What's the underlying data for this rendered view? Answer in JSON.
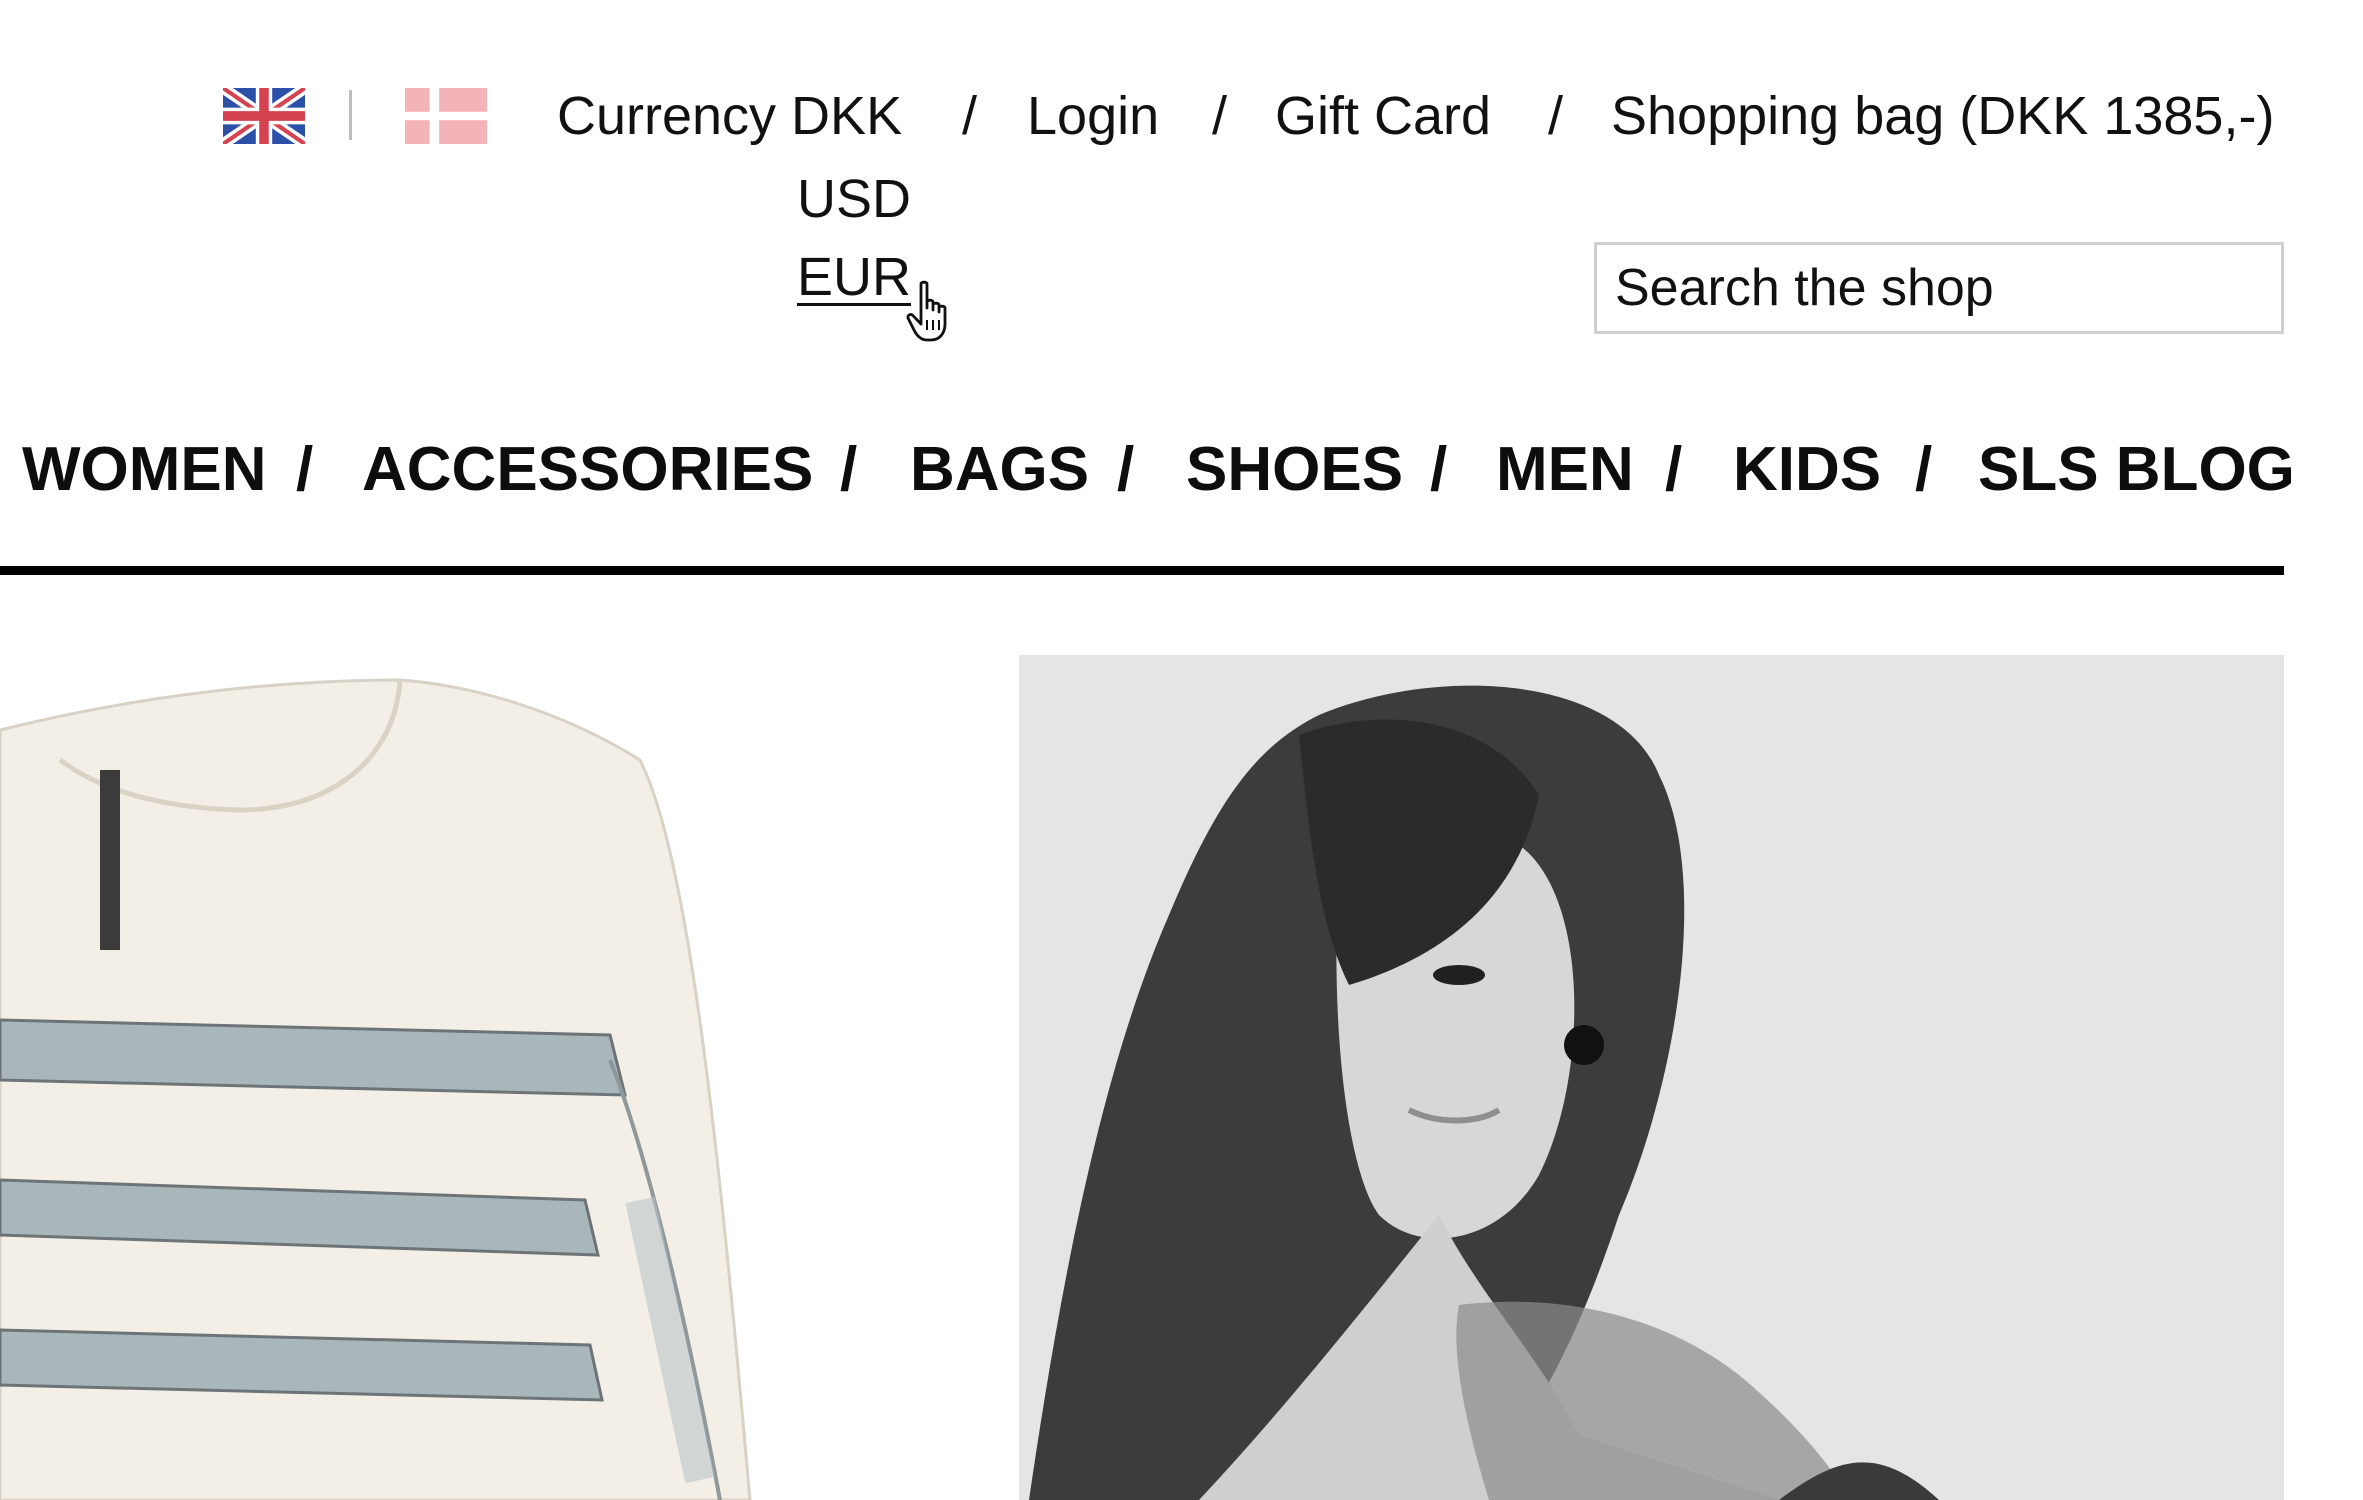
{
  "header": {
    "languages": [
      {
        "name": "English",
        "icon": "uk-flag-icon"
      },
      {
        "name": "Danish",
        "icon": "denmark-flag-icon"
      }
    ],
    "currency_label": "Currency DKK",
    "currency_menu": {
      "options": [
        "USD",
        "EUR"
      ],
      "hovered": "EUR"
    },
    "separator": "/",
    "login_label": "Login",
    "gift_card_label": "Gift Card",
    "bag_label": "Shopping bag (DKK 1385,-)"
  },
  "search": {
    "placeholder": "Search the shop"
  },
  "nav": {
    "items": [
      "WOMEN",
      "ACCESSORIES",
      "BAGS",
      "SHOES",
      "MEN",
      "KIDS",
      "SLS BLOG"
    ],
    "separator": "/"
  },
  "colors": {
    "text": "#111111",
    "rule": "#000000",
    "background": "#ffffff"
  }
}
